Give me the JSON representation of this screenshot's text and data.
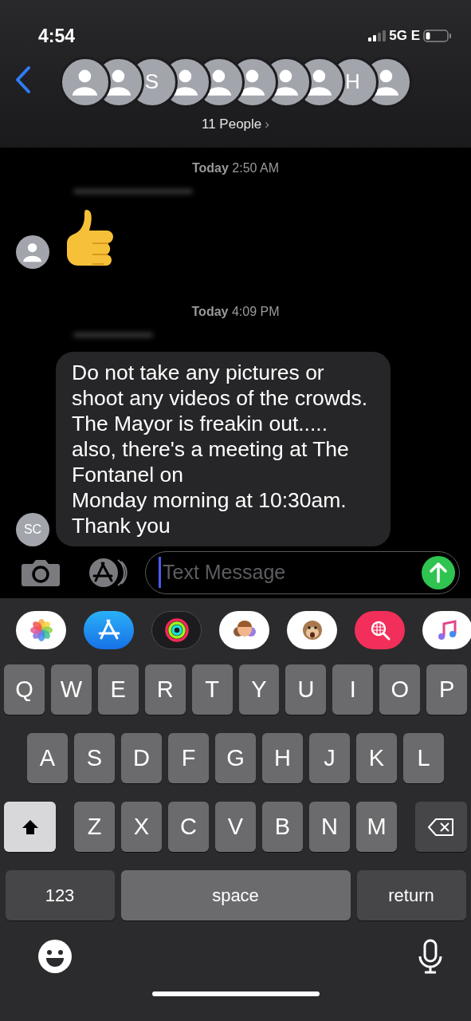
{
  "status_bar": {
    "time": "4:54",
    "network": "5G E"
  },
  "header": {
    "avatars": [
      {
        "kind": "person"
      },
      {
        "kind": "person"
      },
      {
        "kind": "initial",
        "text": "S"
      },
      {
        "kind": "person"
      },
      {
        "kind": "person"
      },
      {
        "kind": "person"
      },
      {
        "kind": "person"
      },
      {
        "kind": "person"
      },
      {
        "kind": "initial",
        "text": "H"
      },
      {
        "kind": "person"
      }
    ],
    "title": "11 People",
    "chevron": "›"
  },
  "messages": [
    {
      "kind": "timestamp",
      "day": "Today",
      "time": "2:50 AM"
    },
    {
      "kind": "emoji",
      "avatar": {
        "kind": "person"
      }
    },
    {
      "kind": "timestamp",
      "day": "Today",
      "time": "4:09 PM"
    },
    {
      "kind": "text",
      "avatar": {
        "kind": "initial",
        "text": "SC"
      },
      "before": "Do not take any pictures or shoot any videos of the crowds. The Mayor is freakin out..... also, there's a meeting at The Fontanel on ",
      "link": "Monday morning at 10:30am",
      "after": ". Thank you"
    }
  ],
  "composer": {
    "placeholder": "Text Message"
  },
  "keyboard": {
    "rows": [
      [
        {
          "label": "Q"
        },
        {
          "label": "W"
        },
        {
          "label": "E"
        },
        {
          "label": "R"
        },
        {
          "label": "T"
        },
        {
          "label": "Y"
        },
        {
          "label": "U"
        },
        {
          "label": "I"
        },
        {
          "label": "O"
        },
        {
          "label": "P"
        }
      ],
      [
        {
          "label": "A"
        },
        {
          "label": "S"
        },
        {
          "label": "D"
        },
        {
          "label": "F"
        },
        {
          "label": "G"
        },
        {
          "label": "H"
        },
        {
          "label": "J"
        },
        {
          "label": "K"
        },
        {
          "label": "L"
        }
      ],
      [
        {
          "kind": "shift",
          "on": true
        },
        {
          "label": "Z"
        },
        {
          "label": "X"
        },
        {
          "label": "C"
        },
        {
          "label": "V"
        },
        {
          "label": "B"
        },
        {
          "label": "N"
        },
        {
          "label": "M"
        },
        {
          "kind": "delete"
        }
      ]
    ],
    "bottom_row": [
      {
        "kind": "special",
        "label": "123"
      },
      {
        "kind": "space",
        "label": "space"
      },
      {
        "kind": "special",
        "label": "return"
      }
    ]
  }
}
